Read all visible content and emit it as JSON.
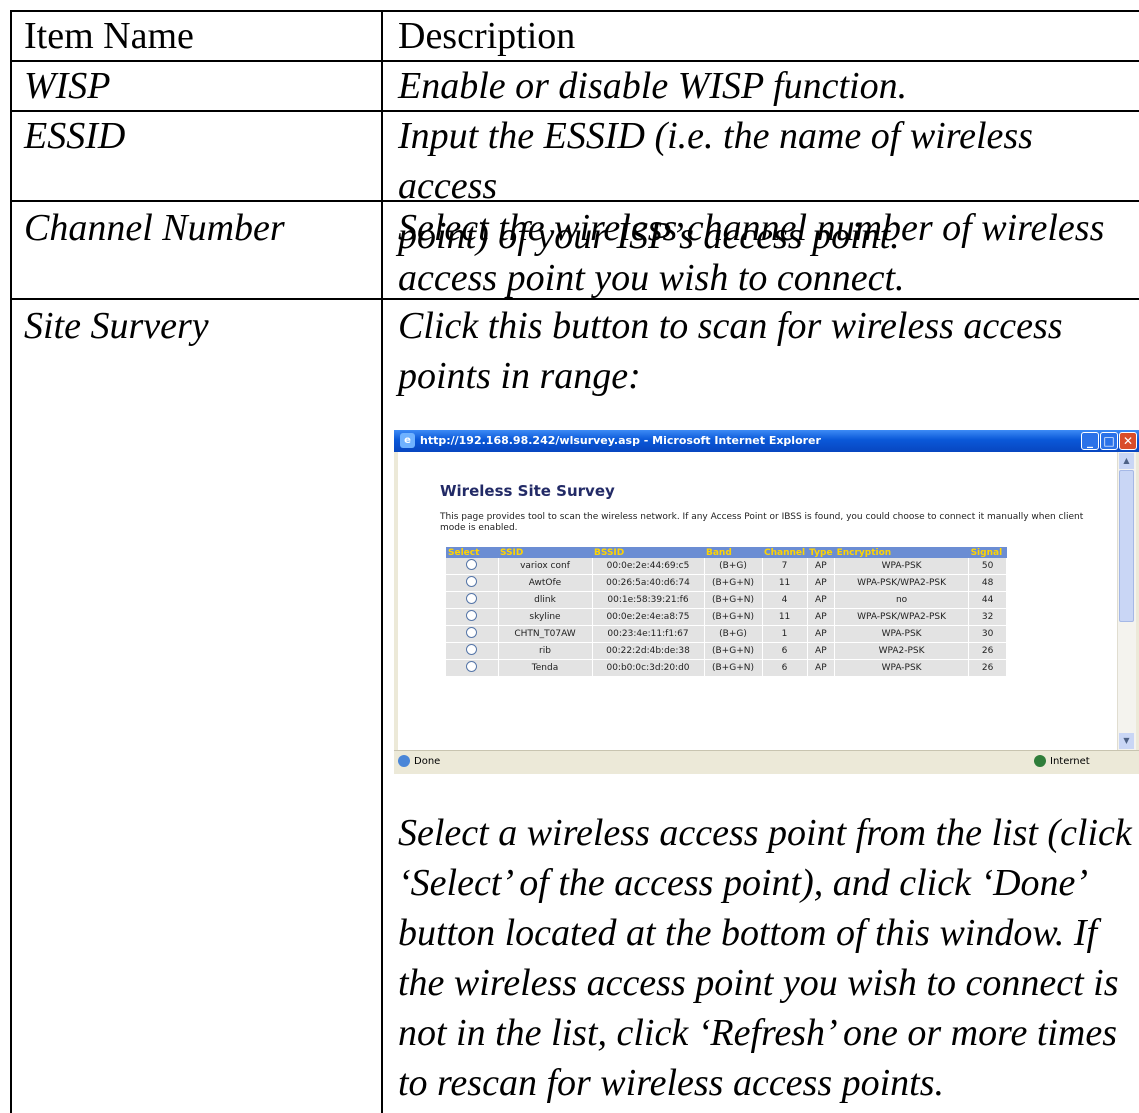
{
  "table": {
    "headers": [
      "Item Name",
      "Description"
    ],
    "rows": [
      {
        "name": "WISP",
        "desc_lines": [
          "Enable or disable WISP function."
        ]
      },
      {
        "name": "ESSID",
        "desc_lines": [
          "Input the ESSID (i.e. the name of wireless access",
          "point) of your ISP’s access point."
        ]
      },
      {
        "name": "Channel Number",
        "desc_lines": [
          "Select the wireless channel number of wireless",
          "access point you wish to connect."
        ]
      },
      {
        "name": "Site Survery",
        "desc_lines": [
          "Click this button to scan for wireless access",
          "points in range:"
        ],
        "after_lines": [
          "Select a wireless access point from the list (click",
          "‘Select’ of the access point), and click ‘Done’",
          "button located at the bottom of this window. If",
          "the wireless access point you wish to connect is",
          "not in the list, click ‘Refresh’ one or more times",
          "to rescan for wireless access points."
        ]
      }
    ]
  },
  "screenshot": {
    "window_title": "http://192.168.98.242/wlsurvey.asp - Microsoft Internet Explorer",
    "page_title": "Wireless Site Survey",
    "description": "This page provides tool to scan the wireless network. If any Access Point or IBSS is found, you could choose to connect it manually when client mode is enabled.",
    "columns": [
      "Select",
      "SSID",
      "BSSID",
      "Band",
      "Channel",
      "Type",
      "Encryption",
      "Signal"
    ],
    "networks": [
      [
        "variox conf",
        "00:0e:2e:44:69:c5",
        "(B+G)",
        "7",
        "AP",
        "WPA-PSK",
        "50"
      ],
      [
        "AwtOfe",
        "00:26:5a:40:d6:74",
        "(B+G+N)",
        "11",
        "AP",
        "WPA-PSK/WPA2-PSK",
        "48"
      ],
      [
        "dlink",
        "00:1e:58:39:21:f6",
        "(B+G+N)",
        "4",
        "AP",
        "no",
        "44"
      ],
      [
        "skyline",
        "00:0e:2e:4e:a8:75",
        "(B+G+N)",
        "11",
        "AP",
        "WPA-PSK/WPA2-PSK",
        "32"
      ],
      [
        "CHTN_T07AW",
        "00:23:4e:11:f1:67",
        "(B+G)",
        "1",
        "AP",
        "WPA-PSK",
        "30"
      ],
      [
        "rib",
        "00:22:2d:4b:de:38",
        "(B+G+N)",
        "6",
        "AP",
        "WPA2-PSK",
        "26"
      ],
      [
        "Tenda",
        "00:b0:0c:3d:20:d0",
        "(B+G+N)",
        "6",
        "AP",
        "WPA-PSK",
        "26"
      ]
    ],
    "status_left": "Done",
    "status_right": "Internet",
    "colors": {
      "titlebar": "#0a58d8",
      "header_bg": "#6b8dd3",
      "header_text": "#ffd400",
      "row_bg": "#e3e3e3"
    }
  }
}
